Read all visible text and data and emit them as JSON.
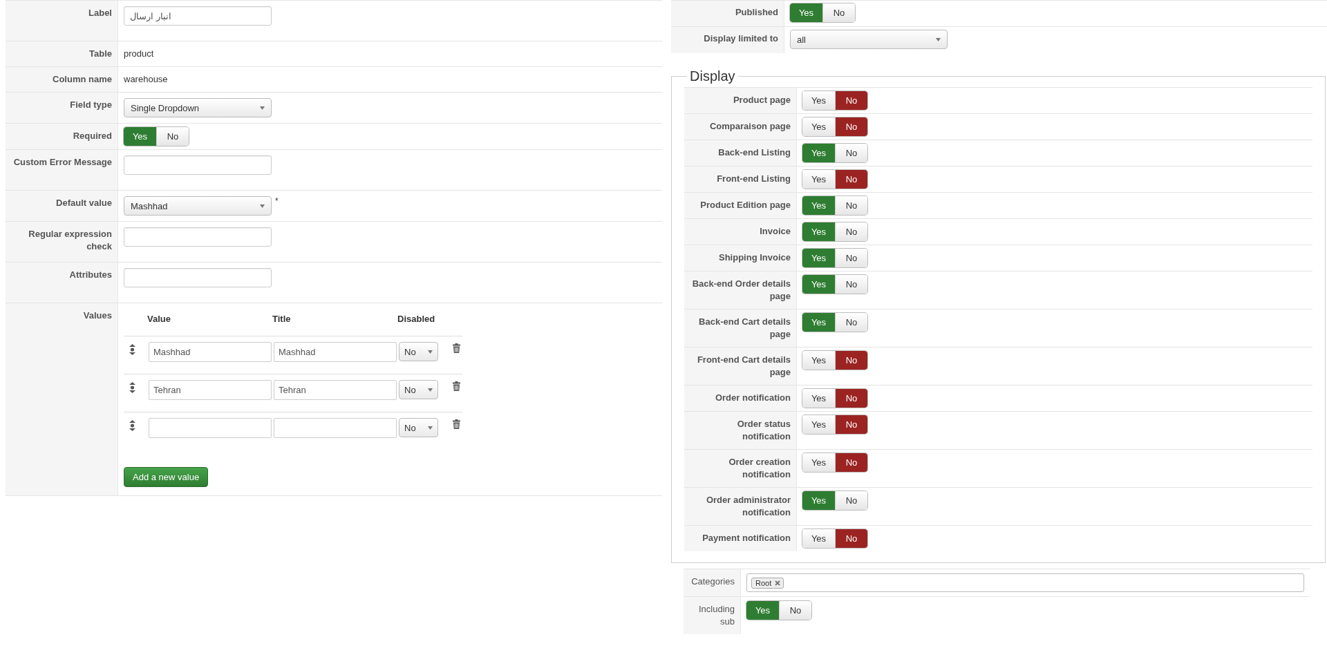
{
  "left_form": {
    "rows": [
      {
        "kind": "input",
        "label": "Label",
        "value": "انبار ارسال"
      },
      {
        "kind": "text",
        "label": "Table",
        "value": "product"
      },
      {
        "kind": "text",
        "label": "Column name",
        "value": "warehouse"
      },
      {
        "kind": "select",
        "label": "Field type",
        "value": "Single Dropdown"
      },
      {
        "kind": "toggle",
        "label": "Required",
        "options": [
          {
            "label": "Yes",
            "selected": true
          },
          {
            "label": "No",
            "selected": false
          }
        ]
      },
      {
        "kind": "input",
        "label": "Custom Error Message"
      },
      {
        "kind": "select",
        "label": "Default value",
        "value": "Mashhad",
        "note": "*"
      },
      {
        "kind": "input",
        "label": "Regular expression check"
      },
      {
        "kind": "input",
        "label": "Attributes"
      },
      {
        "kind": "values",
        "label": "Values",
        "columns": [
          "Value",
          "Title",
          "Disabled"
        ],
        "items": [
          {
            "value": "Mashhad",
            "title": "Mashhad",
            "disabled": "No"
          },
          {
            "value": "Tehran",
            "title": "Tehran",
            "disabled": "No"
          },
          {
            "disabled": "No"
          }
        ],
        "add_button": "Add a new value"
      }
    ]
  },
  "right_form": {
    "rows": [
      {
        "kind": "toggle",
        "label": "Published",
        "options": [
          {
            "label": "Yes",
            "selected": true
          },
          {
            "label": "No",
            "selected": false
          }
        ]
      },
      {
        "kind": "select",
        "label": "Display limited to",
        "value": "all"
      }
    ]
  },
  "display": {
    "legend": "Display",
    "rows": [
      {
        "label": "Product page",
        "options": [
          {
            "label": "Yes",
            "selected": false
          },
          {
            "label": "No",
            "selected": true
          }
        ]
      },
      {
        "label": "Comparaison page",
        "options": [
          {
            "label": "Yes",
            "selected": false
          },
          {
            "label": "No",
            "selected": true
          }
        ]
      },
      {
        "label": "Back-end Listing",
        "options": [
          {
            "label": "Yes",
            "selected": true
          },
          {
            "label": "No",
            "selected": false
          }
        ]
      },
      {
        "label": "Front-end Listing",
        "options": [
          {
            "label": "Yes",
            "selected": false
          },
          {
            "label": "No",
            "selected": true
          }
        ]
      },
      {
        "label": "Product Edition page",
        "options": [
          {
            "label": "Yes",
            "selected": true
          },
          {
            "label": "No",
            "selected": false
          }
        ]
      },
      {
        "label": "Invoice",
        "options": [
          {
            "label": "Yes",
            "selected": true
          },
          {
            "label": "No",
            "selected": false
          }
        ]
      },
      {
        "label": "Shipping Invoice",
        "options": [
          {
            "label": "Yes",
            "selected": true
          },
          {
            "label": "No",
            "selected": false
          }
        ]
      },
      {
        "label": "Back-end Order details page",
        "options": [
          {
            "label": "Yes",
            "selected": true
          },
          {
            "label": "No",
            "selected": false
          }
        ]
      },
      {
        "label": "Back-end Cart details page",
        "options": [
          {
            "label": "Yes",
            "selected": true
          },
          {
            "label": "No",
            "selected": false
          }
        ]
      },
      {
        "label": "Front-end Cart details page",
        "options": [
          {
            "label": "Yes",
            "selected": false
          },
          {
            "label": "No",
            "selected": true
          }
        ]
      },
      {
        "label": "Order notification",
        "options": [
          {
            "label": "Yes",
            "selected": false
          },
          {
            "label": "No",
            "selected": true
          }
        ]
      },
      {
        "label": "Order status notification",
        "options": [
          {
            "label": "Yes",
            "selected": false
          },
          {
            "label": "No",
            "selected": true
          }
        ]
      },
      {
        "label": "Order creation notification",
        "options": [
          {
            "label": "Yes",
            "selected": false
          },
          {
            "label": "No",
            "selected": true
          }
        ]
      },
      {
        "label": "Order administrator notification",
        "options": [
          {
            "label": "Yes",
            "selected": true
          },
          {
            "label": "No",
            "selected": false
          }
        ]
      },
      {
        "label": "Payment notification",
        "options": [
          {
            "label": "Yes",
            "selected": false
          },
          {
            "label": "No",
            "selected": true
          }
        ]
      }
    ]
  },
  "categories": {
    "rows": [
      {
        "kind": "tags",
        "label": "Categories",
        "tags": [
          "Root"
        ]
      },
      {
        "kind": "toggle",
        "label": "Including sub",
        "options": [
          {
            "label": "Yes",
            "selected": true
          },
          {
            "label": "No",
            "selected": false
          }
        ]
      }
    ]
  }
}
